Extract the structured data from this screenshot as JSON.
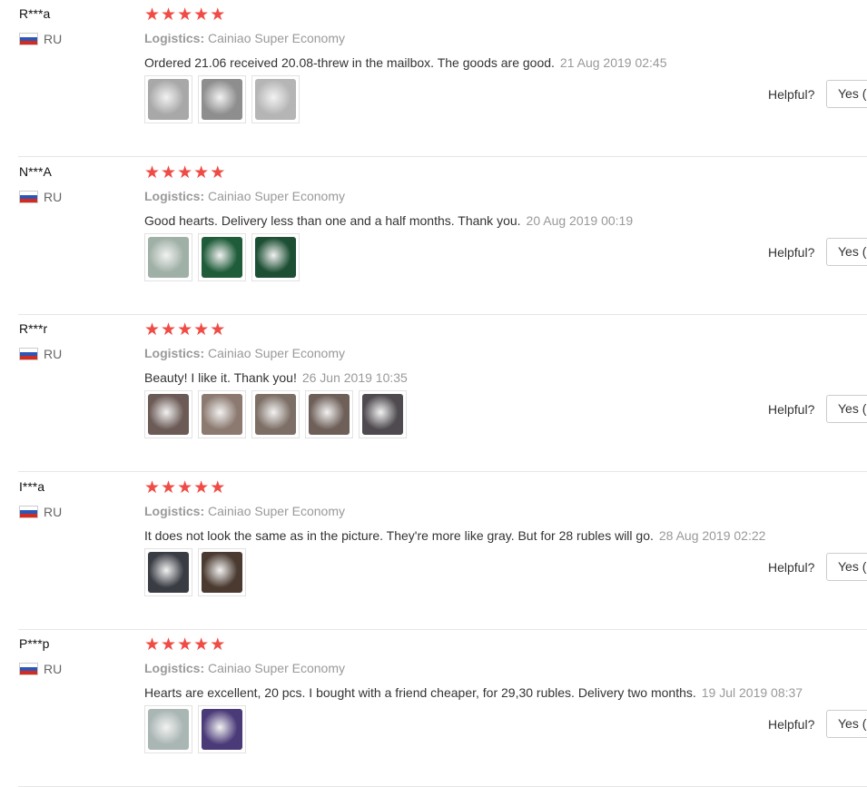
{
  "reviews": [
    {
      "user": "R***a",
      "country": "RU",
      "stars": 5,
      "logistics_label": "Logistics:",
      "logistics_value": "Cainiao Super Economy",
      "text": "Ordered 21.06 received 20.08-threw in the mailbox. The goods are good.",
      "date": "21 Aug 2019 02:45",
      "photos": [
        "#a8a8a8",
        "#8e8e8e",
        "#b5b5b5"
      ],
      "helpful_label": "Helpful?",
      "yes_label": "Yes ("
    },
    {
      "user": "N***A",
      "country": "RU",
      "stars": 5,
      "logistics_label": "Logistics:",
      "logistics_value": "Cainiao Super Economy",
      "text": "Good hearts. Delivery less than one and a half months. Thank you.",
      "date": "20 Aug 2019 00:19",
      "photos": [
        "#9fb0a6",
        "#1f5c3a",
        "#1d4f34"
      ],
      "helpful_label": "Helpful?",
      "yes_label": "Yes ("
    },
    {
      "user": "R***r",
      "country": "RU",
      "stars": 5,
      "logistics_label": "Logistics:",
      "logistics_value": "Cainiao Super Economy",
      "text": "Beauty! I like it. Thank you!",
      "date": "26 Jun 2019 10:35",
      "photos": [
        "#6b5a55",
        "#8c7a70",
        "#7d6f66",
        "#6e5f58",
        "#4e4a4f"
      ],
      "helpful_label": "Helpful?",
      "yes_label": "Yes ("
    },
    {
      "user": "I***a",
      "country": "RU",
      "stars": 5,
      "logistics_label": "Logistics:",
      "logistics_value": "Cainiao Super Economy",
      "text": "It does not look the same as in the picture. They're more like gray. But for 28 rubles will go.",
      "date": "28 Aug 2019 02:22",
      "photos": [
        "#3a3c44",
        "#4a3a30"
      ],
      "helpful_label": "Helpful?",
      "yes_label": "Yes ("
    },
    {
      "user": "P***p",
      "country": "RU",
      "stars": 5,
      "logistics_label": "Logistics:",
      "logistics_value": "Cainiao Super Economy",
      "text": "Hearts are excellent, 20 pcs. I bought with a friend cheaper, for 29,30 rubles. Delivery two months.",
      "date": "19 Jul 2019 08:37",
      "photos": [
        "#a9b6b4",
        "#4a3a78"
      ],
      "helpful_label": "Helpful?",
      "yes_label": "Yes (."
    }
  ],
  "colors": {
    "star": "#ef4c46",
    "divider": "#e6e6e6"
  },
  "icons": {
    "star": "star-icon",
    "flag": "russia-flag-icon"
  }
}
